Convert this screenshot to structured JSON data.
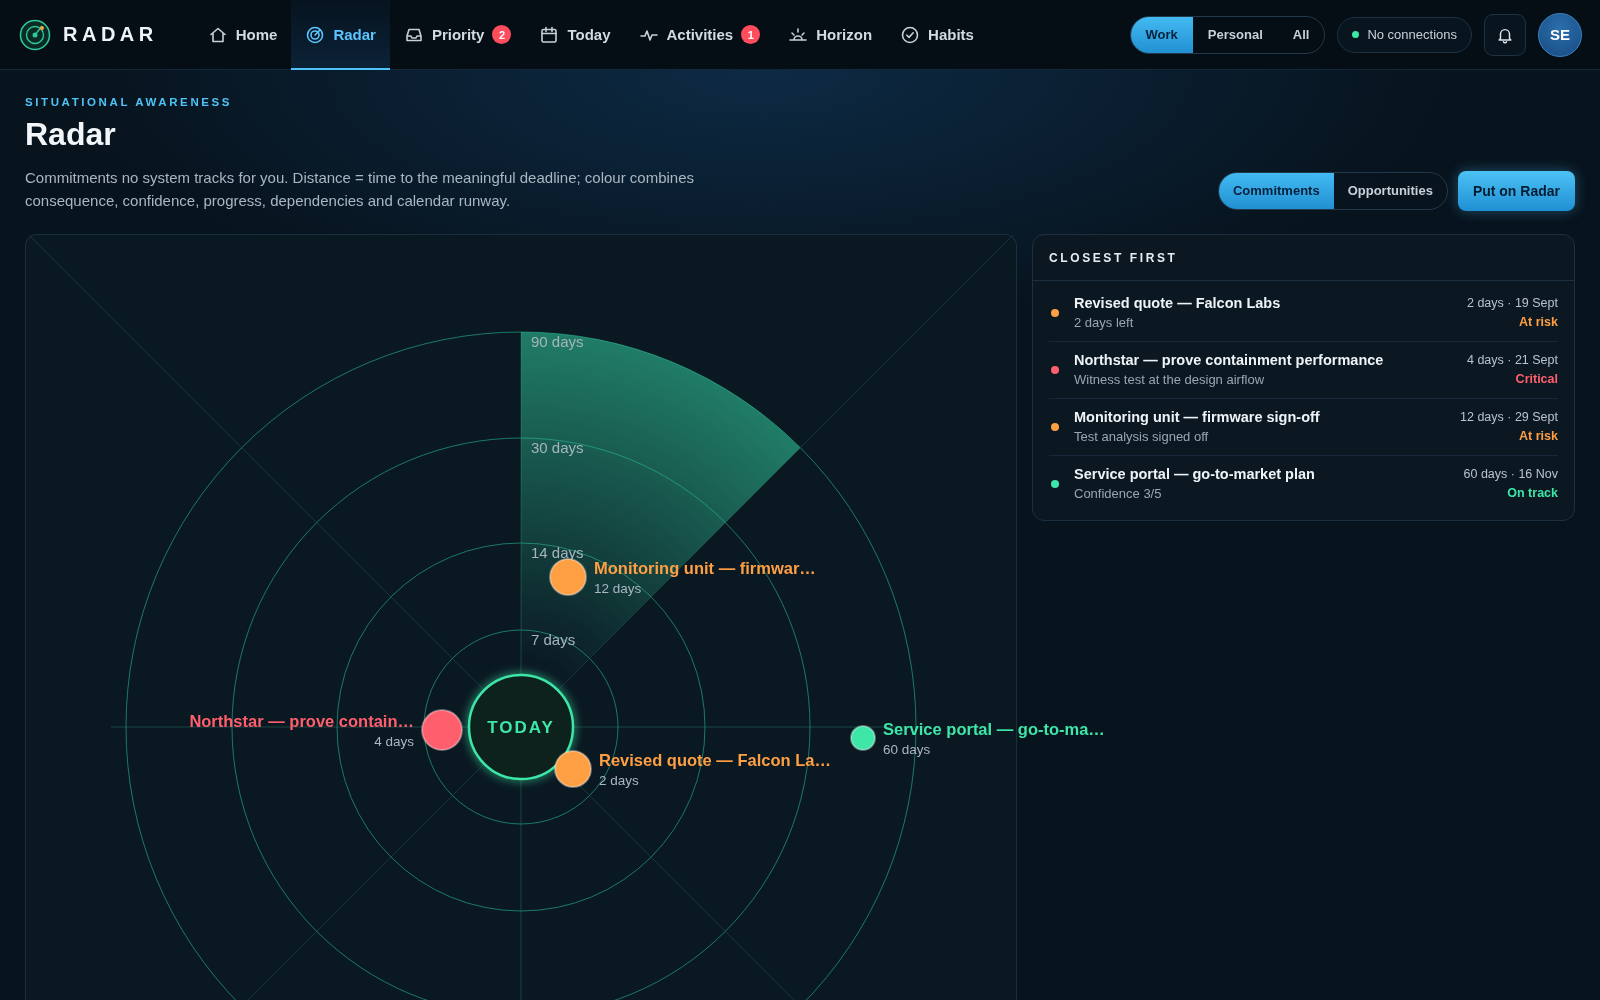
{
  "brand": {
    "name": "RADAR"
  },
  "nav": {
    "items": [
      {
        "label": "Home",
        "selected": false
      },
      {
        "label": "Radar",
        "selected": true
      },
      {
        "label": "Priority",
        "badge": "2",
        "selected": false
      },
      {
        "label": "Today",
        "selected": false
      },
      {
        "label": "Activities",
        "badge": "1",
        "selected": false
      },
      {
        "label": "Horizon",
        "selected": false
      },
      {
        "label": "Habits",
        "selected": false
      }
    ]
  },
  "scope": [
    {
      "label": "Work",
      "selected": true
    },
    {
      "label": "Personal",
      "selected": false
    },
    {
      "label": "All",
      "selected": false
    }
  ],
  "connection": {
    "label": "No connections"
  },
  "user": {
    "initials": "SE"
  },
  "header": {
    "eyebrow": "SITUATIONAL AWARENESS",
    "title": "Radar",
    "description": "Commitments no system tracks for you. Distance = time to the meaningful deadline; colour combines consequence, confidence, progress, dependencies and calendar runway."
  },
  "mode_tabs": [
    {
      "label": "Commitments",
      "selected": true
    },
    {
      "label": "Opportunities",
      "selected": false
    }
  ],
  "primary_action": "Put on Radar",
  "radar": {
    "center": "TODAY",
    "rings": [
      "90 days",
      "30 days",
      "14 days",
      "7 days"
    ],
    "blips": [
      {
        "label": "Monitoring unit — firmwar…",
        "days": "12 days",
        "color": "#ff9f43"
      },
      {
        "label": "Northstar — prove contain…",
        "days": "4 days",
        "color": "#ff5f6d"
      },
      {
        "label": "Revised quote — Falcon La…",
        "days": "2 days",
        "color": "#ff9f43"
      },
      {
        "label": "Service portal — go-to-ma…",
        "days": "60 days",
        "color": "#3ee6a8"
      }
    ]
  },
  "closest": {
    "title": "CLOSEST FIRST",
    "items": [
      {
        "title": "Revised quote — Falcon Labs",
        "subtitle": "2 days left",
        "when": "2 days · 19 Sept",
        "status": "At risk",
        "color": "#ff9f43"
      },
      {
        "title": "Northstar — prove containment performance",
        "subtitle": "Witness test at the design airflow",
        "when": "4 days · 21 Sept",
        "status": "Critical",
        "color": "#ff5f6d"
      },
      {
        "title": "Monitoring unit — firmware sign-off",
        "subtitle": "Test analysis signed off",
        "when": "12 days · 29 Sept",
        "status": "At risk",
        "color": "#ff9f43"
      },
      {
        "title": "Service portal — go-to-market plan",
        "subtitle": "Confidence 3/5",
        "when": "60 days · 16 Nov",
        "status": "On track",
        "color": "#3ee6a8"
      }
    ]
  }
}
